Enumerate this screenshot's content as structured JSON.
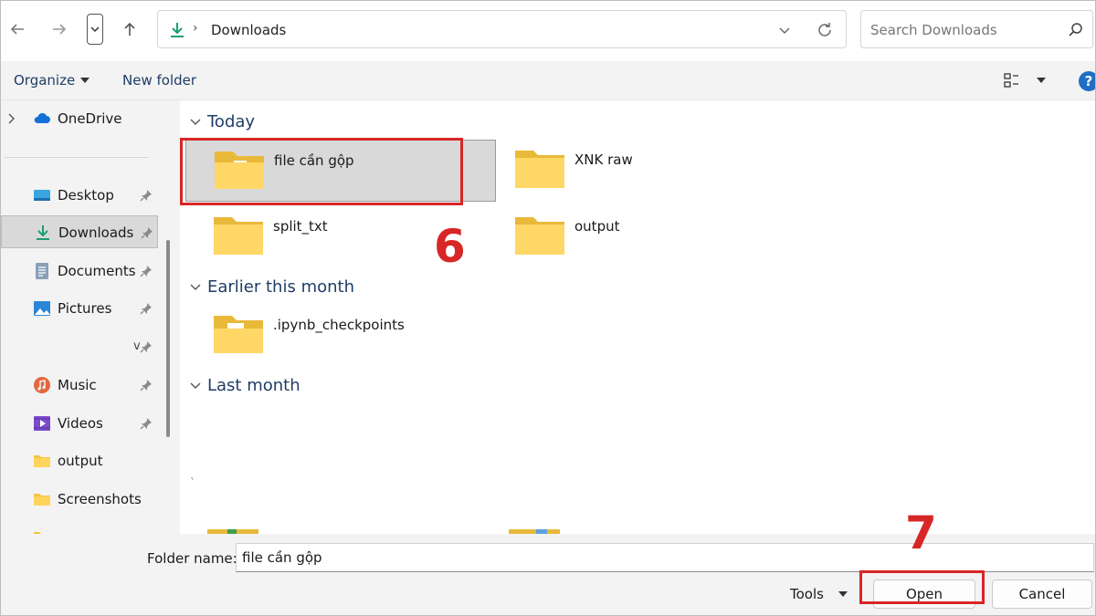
{
  "navigation": {
    "back_icon": "arrow-left-icon",
    "forward_icon": "arrow-right-icon",
    "history_icon": "chevron-down-icon",
    "up_icon": "arrow-up-icon"
  },
  "address_bar": {
    "location_icon": "download-icon",
    "breadcrumb": "Downloads",
    "accent_color": "#1a9f6e"
  },
  "search": {
    "placeholder": "Search Downloads"
  },
  "command_bar": {
    "organize_label": "Organize",
    "new_folder_label": "New folder",
    "help_label": "?"
  },
  "sidebar": {
    "items": [
      {
        "label": "OneDrive",
        "icon": "cloud-icon",
        "pinned": false
      },
      {
        "label": "Desktop",
        "icon": "desktop-icon",
        "pinned": true
      },
      {
        "label": "Downloads",
        "icon": "download-icon",
        "pinned": true,
        "selected": true
      },
      {
        "label": "Documents",
        "icon": "document-icon",
        "pinned": true
      },
      {
        "label": "Pictures",
        "icon": "picture-icon",
        "pinned": true
      },
      {
        "label": "v",
        "icon": "",
        "pinned": true
      },
      {
        "label": "Music",
        "icon": "music-icon",
        "pinned": true
      },
      {
        "label": "Videos",
        "icon": "video-icon",
        "pinned": true
      },
      {
        "label": "output",
        "icon": "folder-icon",
        "pinned": false
      },
      {
        "label": "Screenshots",
        "icon": "folder-icon",
        "pinned": false
      }
    ]
  },
  "content": {
    "groups": [
      {
        "header": "Today"
      },
      {
        "header": "Earlier this month"
      },
      {
        "header": "Last month"
      }
    ],
    "folders": [
      {
        "name": "file cần gộp",
        "group": "Today",
        "selected": true
      },
      {
        "name": "XNK raw",
        "group": "Today",
        "selected": false
      },
      {
        "name": "split_txt",
        "group": "Today",
        "selected": false
      },
      {
        "name": "output",
        "group": "Today",
        "selected": false
      },
      {
        "name": ".ipynb_checkpoints",
        "group": "Earlier this month",
        "selected": false
      }
    ],
    "stray_mark": "`"
  },
  "footer": {
    "folder_name_label": "Folder name:",
    "folder_name_value": "file cần gộp",
    "tools_label": "Tools",
    "open_label": "Open",
    "cancel_label": "Cancel"
  },
  "annotations": {
    "step_6": "6",
    "step_7": "7",
    "color": "#d72626"
  }
}
